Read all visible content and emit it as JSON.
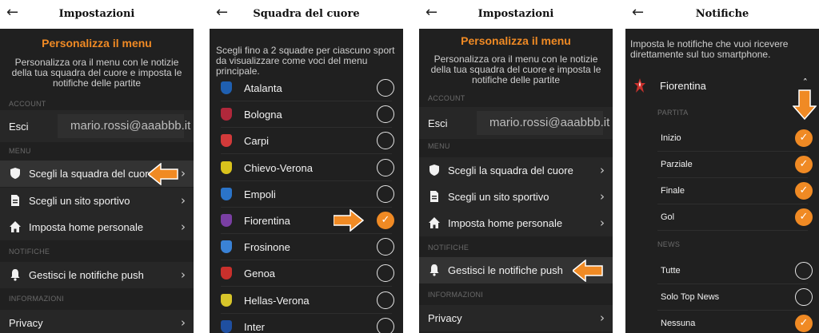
{
  "colors": {
    "accent": "#f08a24",
    "bg": "#202020",
    "row": "#272727"
  },
  "panel1": {
    "title": "Impostazioni",
    "promo_title": "Personalizza il menu",
    "promo_text": "Personalizza ora il menu con le notizie della tua squadra del cuore e imposta le notifiche delle partite",
    "section_account": "ACCOUNT",
    "esci": "Esci",
    "email": "mario.rossi@aaabbb.it",
    "section_menu": "MENU",
    "items": [
      {
        "label": "Scegli la squadra del cuore",
        "icon": "shield-icon"
      },
      {
        "label": "Scegli un sito sportivo",
        "icon": "document-icon"
      },
      {
        "label": "Imposta home personale",
        "icon": "home-icon"
      }
    ],
    "section_notifiche": "NOTIFICHE",
    "notif_item": "Gestisci le notifiche push",
    "section_info": "INFORMAZIONI",
    "privacy": "Privacy"
  },
  "panel2": {
    "title": "Squadra del cuore",
    "intro": "Scegli fino a 2 squadre per ciascuno sport da visualizzare come voci del menu principale.",
    "teams": [
      {
        "name": "Atalanta",
        "color": "#1f5fb0",
        "selected": false
      },
      {
        "name": "Bologna",
        "color": "#b0283b",
        "selected": false
      },
      {
        "name": "Carpi",
        "color": "#d23a3a",
        "selected": false
      },
      {
        "name": "Chievo-Verona",
        "color": "#d9c21c",
        "selected": false
      },
      {
        "name": "Empoli",
        "color": "#2b74c9",
        "selected": false
      },
      {
        "name": "Fiorentina",
        "color": "#7a3fa3",
        "selected": true
      },
      {
        "name": "Frosinone",
        "color": "#3a82d6",
        "selected": false
      },
      {
        "name": "Genoa",
        "color": "#c9302c",
        "selected": false
      },
      {
        "name": "Hellas-Verona",
        "color": "#d7c52a",
        "selected": false
      },
      {
        "name": "Inter",
        "color": "#1f4fa0",
        "selected": false
      }
    ]
  },
  "panel3": {
    "title": "Impostazioni",
    "promo_title": "Personalizza il menu",
    "promo_text": "Personalizza ora il menu con le notizie della tua squadra del cuore e imposta le notifiche delle partite",
    "section_account": "ACCOUNT",
    "esci": "Esci",
    "email": "mario.rossi@aaabbb.it",
    "section_menu": "MENU",
    "items": [
      {
        "label": "Scegli la squadra del cuore",
        "icon": "shield-icon"
      },
      {
        "label": "Scegli un sito sportivo",
        "icon": "document-icon"
      },
      {
        "label": "Imposta home personale",
        "icon": "home-icon"
      }
    ],
    "section_notifiche": "NOTIFICHE",
    "notif_item": "Gestisci le notifiche push",
    "section_info": "INFORMAZIONI",
    "privacy": "Privacy"
  },
  "panel4": {
    "title": "Notifiche",
    "intro": "Imposta le notifiche che vuoi ricevere direttamente sul tuo smartphone.",
    "team": "Fiorentina",
    "section_partita": "PARTITA",
    "partita": [
      {
        "label": "Inizio",
        "on": true
      },
      {
        "label": "Parziale",
        "on": true
      },
      {
        "label": "Finale",
        "on": true
      },
      {
        "label": "Gol",
        "on": true
      }
    ],
    "section_news": "NEWS",
    "news": [
      {
        "label": "Tutte",
        "on": false
      },
      {
        "label": "Solo Top News",
        "on": false
      },
      {
        "label": "Nessuna",
        "on": true
      }
    ]
  }
}
